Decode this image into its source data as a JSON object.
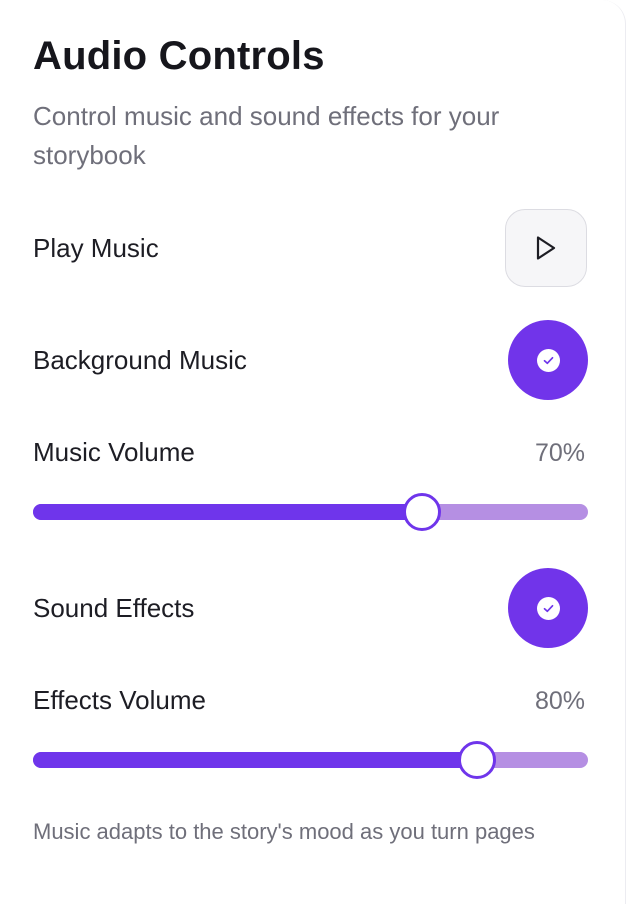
{
  "header": {
    "title": "Audio Controls",
    "subtitle": "Control music and sound effects for your storybook"
  },
  "controls": {
    "play_music": {
      "label": "Play Music",
      "icon": "play-icon"
    },
    "background_music": {
      "label": "Background Music",
      "enabled": true,
      "icon": "check-icon"
    },
    "music_volume": {
      "label": "Music Volume",
      "value_text": "70%",
      "value": 0.7
    },
    "sound_effects": {
      "label": "Sound Effects",
      "enabled": true,
      "icon": "check-icon"
    },
    "effects_volume": {
      "label": "Effects Volume",
      "value_text": "80%",
      "value": 0.8
    }
  },
  "footer": {
    "note": "Music adapts to the story's mood as you turn pages"
  },
  "colors": {
    "accent": "#6F35EB",
    "track": "#B58FE3",
    "muted_text": "#6F6F7A",
    "heading_text": "#16161C"
  }
}
